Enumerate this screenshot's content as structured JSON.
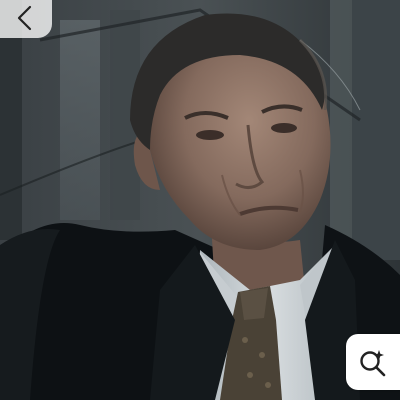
{
  "viewer": {
    "photo_name": "photo",
    "back_button": {
      "icon": "chevron-left-icon"
    },
    "visual_search_button": {
      "icon": "magnifier-sparkle-icon"
    }
  },
  "colors": {
    "button_background": "#ffffff",
    "icon_color": "#222222",
    "backdrop": "#2a3034",
    "coat": "#0d1114",
    "shirt": "#cdd3d6",
    "tie": "#4a4236",
    "skin": "#8c7366",
    "hair": "#2c2b2a"
  }
}
